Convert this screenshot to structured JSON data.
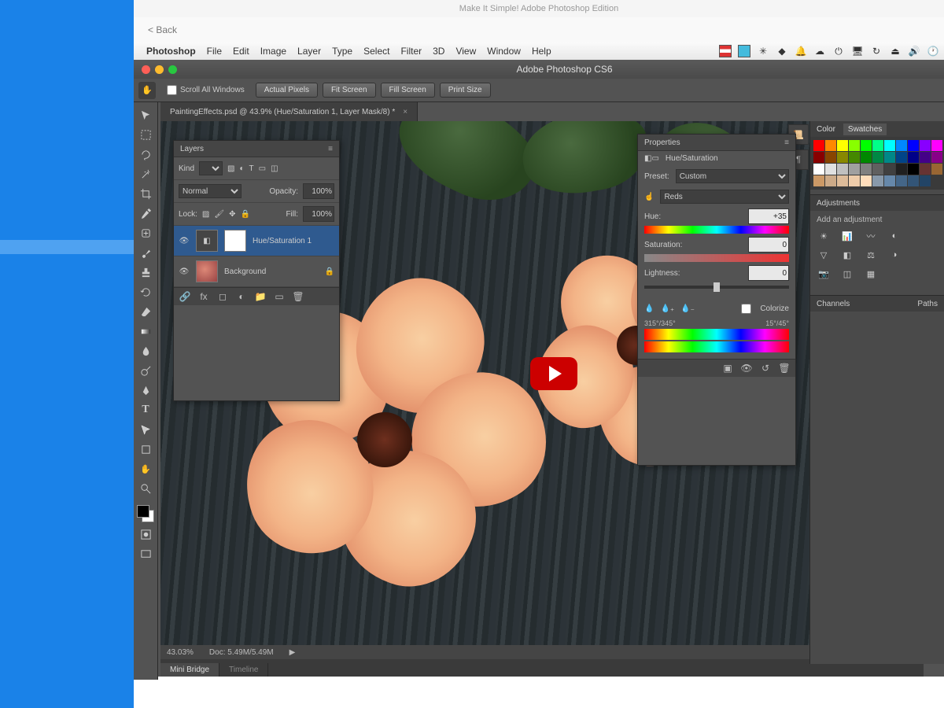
{
  "outer": {
    "title": "Make It Simple! Adobe Photoshop Edition",
    "back": "< Back"
  },
  "mac_menu": {
    "app": "Photoshop",
    "items": [
      "File",
      "Edit",
      "Image",
      "Layer",
      "Type",
      "Select",
      "Filter",
      "3D",
      "View",
      "Window",
      "Help"
    ]
  },
  "window": {
    "title": "Adobe Photoshop CS6"
  },
  "options": {
    "scroll_all": "Scroll All Windows",
    "btns": [
      "Actual Pixels",
      "Fit Screen",
      "Fill Screen",
      "Print Size"
    ]
  },
  "doc_tab": "PaintingEffects.psd @ 43.9% (Hue/Saturation 1, Layer Mask/8) *",
  "status": {
    "zoom": "43.03%",
    "doc": "Doc: 5.49M/5.49M"
  },
  "bottom_tabs": [
    "Mini Bridge",
    "Timeline"
  ],
  "layers": {
    "title": "Layers",
    "kind": "Kind",
    "blend": "Normal",
    "opacity_label": "Opacity:",
    "opacity": "100%",
    "lock_label": "Lock:",
    "fill_label": "Fill:",
    "fill": "100%",
    "items": [
      {
        "name": "Hue/Saturation 1",
        "active": true,
        "type": "adj"
      },
      {
        "name": "Background",
        "active": false,
        "type": "bg"
      }
    ]
  },
  "properties": {
    "title": "Properties",
    "subtitle": "Hue/Saturation",
    "preset_label": "Preset:",
    "preset": "Custom",
    "channel": "Reds",
    "hue_label": "Hue:",
    "hue": "+35",
    "sat_label": "Saturation:",
    "sat": "0",
    "light_label": "Lightness:",
    "light": "0",
    "colorize": "Colorize",
    "range_left": "315°/345°",
    "range_right": "15°/45°"
  },
  "dock": {
    "color_tab": "Color",
    "swatch_tab": "Swatches",
    "adjustments": "Adjustments",
    "add_adj": "Add an adjustment",
    "channels": "Channels",
    "paths": "Paths"
  },
  "swatches": [
    "#ff0000",
    "#ff8800",
    "#ffff00",
    "#88ff00",
    "#00ff00",
    "#00ff88",
    "#00ffff",
    "#0088ff",
    "#0000ff",
    "#8800ff",
    "#ff00ff",
    "#880000",
    "#884400",
    "#888800",
    "#448800",
    "#008800",
    "#008844",
    "#008888",
    "#004488",
    "#000088",
    "#440088",
    "#880088",
    "#ffffff",
    "#e0e0e0",
    "#c0c0c0",
    "#a0a0a0",
    "#808080",
    "#606060",
    "#404040",
    "#202020",
    "#000000",
    "#663333",
    "#996633",
    "#cc9966",
    "#ccaa88",
    "#ddbb99",
    "#eeccaa",
    "#ffddbb",
    "#8899aa",
    "#6688aa",
    "#446688",
    "#335577",
    "#224466"
  ]
}
